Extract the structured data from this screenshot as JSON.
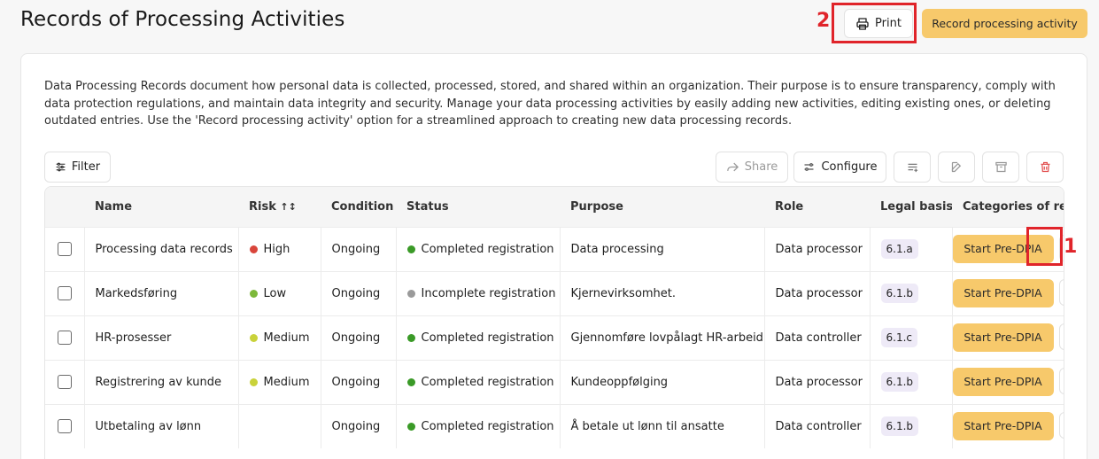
{
  "header": {
    "title": "Records of Processing Activities",
    "print_label": "Print",
    "record_label": "Record processing activity"
  },
  "annotations": [
    "1",
    "2"
  ],
  "colors": {
    "accent": "#f7c96b",
    "annotation": "#e0242a",
    "risk_high": "#d9453b",
    "risk_low": "#7cb83a",
    "risk_medium": "#c9d23a",
    "status_completed": "#3a9a27",
    "status_incomplete": "#9a9a9a"
  },
  "description": "Data Processing Records document how personal data is collected, processed, stored, and shared within an organization. Their purpose is to ensure transparency, comply with data protection regulations, and maintain data integrity and security. Manage your data processing activities by easily adding new activities, editing existing ones, or deleting outdated entries. Use the 'Record processing activity' option for a streamlined approach to creating new data processing records.",
  "toolbar": {
    "filter_label": "Filter",
    "share_label": "Share",
    "configure_label": "Configure"
  },
  "table": {
    "columns": [
      "Name",
      "Risk",
      "Condition",
      "Status",
      "Purpose",
      "Role",
      "Legal basis",
      "Categories of regist"
    ],
    "risk_sort_icon": "↑↕",
    "rows": [
      {
        "name": "Processing data records",
        "risk": "High",
        "risk_color": "#d9453b",
        "condition": "Ongoing",
        "status": "Completed registration",
        "status_color": "#3a9a27",
        "purpose": "Data processing",
        "role": "Data processor",
        "legal": "6.1.a",
        "action": "Start Pre-DPIA"
      },
      {
        "name": "Markedsføring",
        "risk": "Low",
        "risk_color": "#7cb83a",
        "condition": "Ongoing",
        "status": "Incomplete registration",
        "status_color": "#9a9a9a",
        "purpose": "Kjernevirksomhet.",
        "role": "Data processor",
        "legal": "6.1.b",
        "action": "Start Pre-DPIA"
      },
      {
        "name": "HR-prosesser",
        "risk": "Medium",
        "risk_color": "#c9d23a",
        "condition": "Ongoing",
        "status": "Completed registration",
        "status_color": "#3a9a27",
        "purpose": "Gjennomføre lovpålagt HR-arbeid",
        "role": "Data controller",
        "legal": "6.1.c",
        "action": "Start Pre-DPIA"
      },
      {
        "name": "Registrering av kunde",
        "risk": "Medium",
        "risk_color": "#c9d23a",
        "condition": "Ongoing",
        "status": "Completed registration",
        "status_color": "#3a9a27",
        "purpose": "Kundeoppfølging",
        "role": "Data processor",
        "legal": "6.1.b",
        "action": "Start Pre-DPIA"
      },
      {
        "name": "Utbetaling av lønn",
        "risk": "",
        "risk_color": "",
        "condition": "Ongoing",
        "status": "Completed registration",
        "status_color": "#3a9a27",
        "purpose": "Å betale ut lønn til ansatte",
        "role": "Data controller",
        "legal": "6.1.b",
        "action": "Start Pre-DPIA"
      }
    ]
  }
}
